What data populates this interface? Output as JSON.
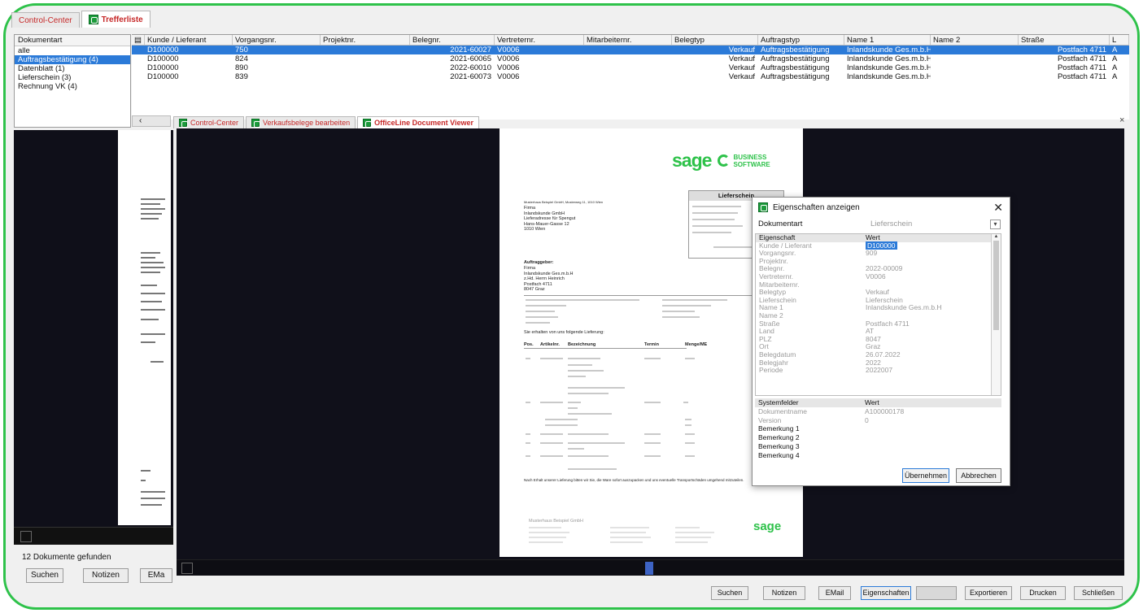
{
  "tabs": {
    "control_center": "Control-Center",
    "trefferliste": "Trefferliste"
  },
  "doctype": {
    "header": "Dokumentart",
    "items": [
      "alle",
      "Auftragsbestätigung (4)",
      "Datenblatt (1)",
      "Lieferschein (3)",
      "Rechnung VK (4)"
    ],
    "selected_index": 1
  },
  "grid": {
    "columns": [
      "Kunde / Lieferant",
      "Vorgangsnr.",
      "Projektnr.",
      "Belegnr.",
      "Vertreternr.",
      "Mitarbeiternr.",
      "Belegtyp",
      "Auftragstyp",
      "Name 1",
      "Name 2",
      "Straße",
      "L"
    ],
    "rows": [
      {
        "kunde": "D100000",
        "vorgang": "750",
        "projekt": "",
        "beleg": "2021-60027",
        "vertreter": "V0006",
        "mitarbeiter": "",
        "belegtyp": "Verkauf",
        "auftragstyp": "Auftragsbestätigung",
        "name1": "Inlandskunde Ges.m.b.H",
        "name2": "",
        "strasse": "Postfach 4711",
        "l": "A"
      },
      {
        "kunde": "D100000",
        "vorgang": "824",
        "projekt": "",
        "beleg": "2021-60065",
        "vertreter": "V0006",
        "mitarbeiter": "",
        "belegtyp": "Verkauf",
        "auftragstyp": "Auftragsbestätigung",
        "name1": "Inlandskunde Ges.m.b.H",
        "name2": "",
        "strasse": "Postfach 4711",
        "l": "A"
      },
      {
        "kunde": "D100000",
        "vorgang": "890",
        "projekt": "",
        "beleg": "2022-60010",
        "vertreter": "V0006",
        "mitarbeiter": "",
        "belegtyp": "Verkauf",
        "auftragstyp": "Auftragsbestätigung",
        "name1": "Inlandskunde Ges.m.b.H",
        "name2": "",
        "strasse": "Postfach 4711",
        "l": "A"
      },
      {
        "kunde": "D100000",
        "vorgang": "839",
        "projekt": "",
        "beleg": "2021-60073",
        "vertreter": "V0006",
        "mitarbeiter": "",
        "belegtyp": "Verkauf",
        "auftragstyp": "Auftragsbestätigung",
        "name1": "Inlandskunde Ges.m.b.H",
        "name2": "",
        "strasse": "Postfach 4711",
        "l": "A"
      }
    ],
    "selected_index": 0
  },
  "left_footer": {
    "found": "12 Dokumente gefunden",
    "buttons": [
      "Suchen",
      "Notizen",
      "EMa"
    ]
  },
  "viewer": {
    "tabs": [
      "Control-Center",
      "Verkaufsbelege bearbeiten",
      "OfficeLine Document Viewer"
    ],
    "close": "×"
  },
  "page": {
    "logo_main": "sage",
    "logo_bs_1": "BUSINESS",
    "logo_bs_2": "SOFTWARE",
    "doc_title": "Lieferschein",
    "sender_line": "Musterhaus Beispiel GmbH, Musterweg 11, 1010 Wien",
    "addr": [
      "Firma",
      "Inlandskunde GmbH",
      "Lieferadresse für Spengut",
      "Hans-Mauer-Gasse 12",
      "1010 Wien"
    ],
    "auftraggeber_head": "Auftraggeber:",
    "auftraggeber": [
      "Firma",
      "Inlandskunde Ges.m.b.H",
      "z.Hd. Herrn Heinrich",
      "Postfach 4711",
      "8047 Graz"
    ],
    "intro": "Sie erhalten von uns folgende Lieferung:",
    "table_head": [
      "Pos.",
      "Artikelnr.",
      "Bezeichnung",
      "Termin",
      "Menge/ME"
    ],
    "footer_text": "Nach Erhalt unserer Lieferung bitten wir Sie, die Ware sofort auszupacken und uns eventuelle Transportschäden umgehend mitzuteilen.",
    "footer_company": "Musterhaus Beispiel GmbH",
    "footer_logo": "sage"
  },
  "dialog": {
    "title": "Eigenschaften anzeigen",
    "doctype_label": "Dokumentart",
    "doctype_value": "Lieferschein",
    "prop_header": [
      "Eigenschaft",
      "Wert"
    ],
    "props": [
      {
        "k": "Kunde / Lieferant",
        "v": "D100000"
      },
      {
        "k": "Vorgangsnr.",
        "v": "909"
      },
      {
        "k": "Projektnr.",
        "v": ""
      },
      {
        "k": "Belegnr.",
        "v": "2022-00009"
      },
      {
        "k": "Vertreternr.",
        "v": "V0006"
      },
      {
        "k": "Mitarbeiternr.",
        "v": ""
      },
      {
        "k": "Belegtyp",
        "v": "Verkauf"
      },
      {
        "k": "Lieferschein",
        "v": "Lieferschein"
      },
      {
        "k": "Name 1",
        "v": "Inlandskunde Ges.m.b.H"
      },
      {
        "k": "Name 2",
        "v": ""
      },
      {
        "k": "Straße",
        "v": "Postfach 4711"
      },
      {
        "k": "Land",
        "v": "AT"
      },
      {
        "k": "PLZ",
        "v": "8047"
      },
      {
        "k": "Ort",
        "v": "Graz"
      },
      {
        "k": "Belegdatum",
        "v": "26.07.2022"
      },
      {
        "k": "Belegjahr",
        "v": "2022"
      },
      {
        "k": "Periode",
        "v": "2022007"
      }
    ],
    "sys_header": [
      "Systemfelder",
      "Wert"
    ],
    "sys": [
      {
        "k": "Dokumentname",
        "v": "A100000178"
      },
      {
        "k": "Version",
        "v": "0"
      },
      {
        "k": "Bemerkung 1",
        "v": ""
      },
      {
        "k": "Bemerkung 2",
        "v": ""
      },
      {
        "k": "Bemerkung 3",
        "v": ""
      },
      {
        "k": "Bemerkung 4",
        "v": ""
      }
    ],
    "ok": "Übernehmen",
    "cancel": "Abbrechen"
  },
  "toolbar": {
    "buttons": [
      "Suchen",
      "Notizen",
      "EMail",
      "Eigenschaften",
      "",
      "Exportieren",
      "Drucken",
      "Schließen"
    ]
  },
  "colors": {
    "accent": "#2b7ad8",
    "brand_green": "#2ec24a",
    "tab_red": "#c62828",
    "viewer_bg": "#10101a"
  }
}
